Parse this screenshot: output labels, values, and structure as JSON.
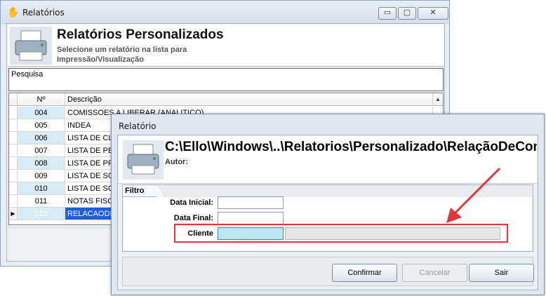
{
  "back_window": {
    "title": "Relatórios",
    "header_title": "Relatórios Personalizados",
    "header_subtitle": "Selecione um relatório na lista para Impressão/Visualização",
    "search_label": "Pesquisa",
    "columns": [
      "Nº",
      "Descrição"
    ],
    "rows": [
      {
        "num": "004",
        "desc": "COMISSOES A LIBERAR (ANALITICO)"
      },
      {
        "num": "005",
        "desc": "INDEA"
      },
      {
        "num": "006",
        "desc": "LISTA DE CL"
      },
      {
        "num": "007",
        "desc": "LISTA DE PE"
      },
      {
        "num": "008",
        "desc": "LISTA DE PR"
      },
      {
        "num": "009",
        "desc": "LISTA DE SO"
      },
      {
        "num": "010",
        "desc": "LISTA DE SO"
      },
      {
        "num": "011",
        "desc": "NOTAS FISC"
      },
      {
        "num": "012",
        "desc": "RELACAODE"
      }
    ],
    "controls": {
      "minimize": "▭",
      "maximize": "▢",
      "close": "✕"
    }
  },
  "dialog": {
    "title": "Relatório",
    "path": "C:\\Ello\\Windows\\..\\Relatorios\\Personalizado\\RelaçãoDeComprasPorCliente",
    "autor_label": "Autor:",
    "filter_tab": "Filtro",
    "fields": {
      "data_inicial": {
        "label": "Data Inicial:",
        "value": ""
      },
      "data_final": {
        "label": "Data Final:",
        "value": ""
      },
      "cliente": {
        "label": "Cliente",
        "value": ""
      }
    },
    "buttons": {
      "confirm": "Confirmar",
      "cancel": "Cancelar",
      "exit": "Sair"
    }
  },
  "colors": {
    "selection": "#1f5fd4",
    "highlight": "#e0383a",
    "focus_field": "#bfe6f7"
  }
}
